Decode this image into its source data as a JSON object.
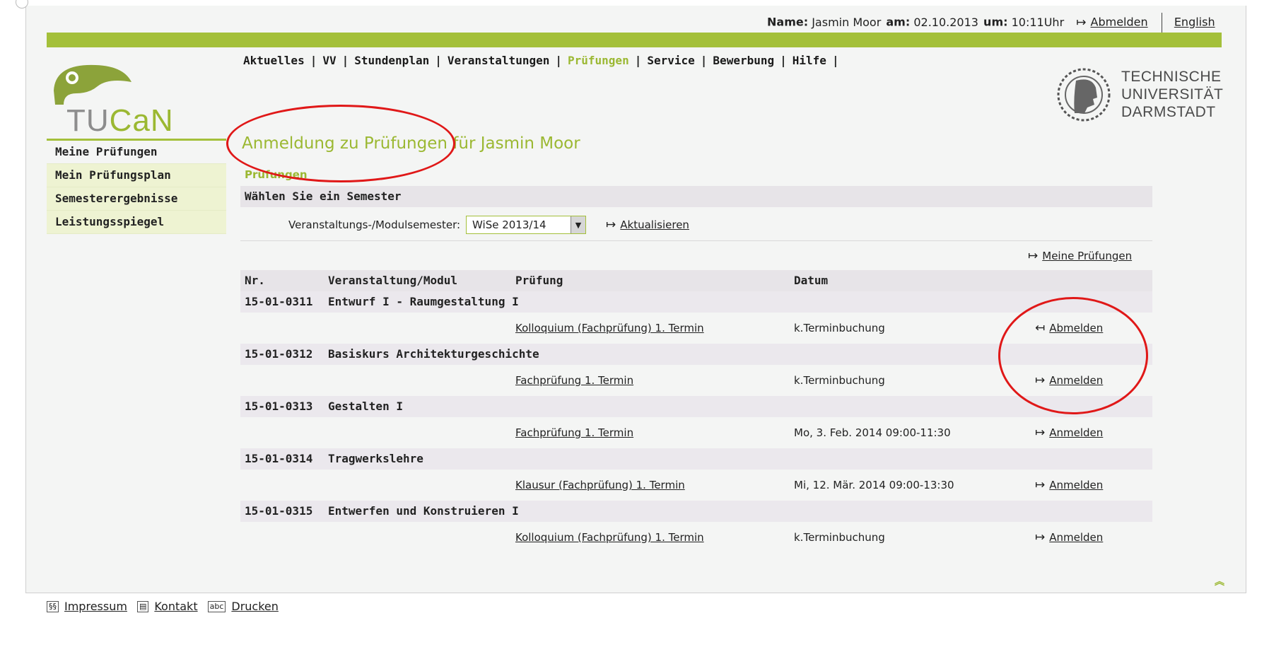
{
  "header": {
    "name_label": "Name:",
    "name_value": "Jasmin Moor",
    "date_label": "am:",
    "date_value": "02.10.2013",
    "time_label": "um:",
    "time_value": "10:11Uhr",
    "logout_label": "Abmelden",
    "language_label": "English"
  },
  "main_nav": [
    "Aktuelles",
    "VV",
    "Stundenplan",
    "Veranstaltungen",
    "Prüfungen",
    "Service",
    "Bewerbung",
    "Hilfe"
  ],
  "main_nav_active": "Prüfungen",
  "logo": {
    "text_prefix": "TU",
    "text_suffix": "CaN"
  },
  "university": {
    "line1": "TECHNISCHE",
    "line2": "UNIVERSITÄT",
    "line3": "DARMSTADT"
  },
  "sidebar": {
    "items": [
      {
        "label": "Meine Prüfungen"
      },
      {
        "label": "Mein Prüfungsplan"
      },
      {
        "label": "Semesterergebnisse"
      },
      {
        "label": "Leistungsspiegel"
      }
    ]
  },
  "page": {
    "title": "Anmeldung zu Prüfungen für Jasmin Moor",
    "breadcrumb": "Prüfungen",
    "semester_section_title": "Wählen Sie ein Semester",
    "semester_label": "Veranstaltungs-/Modulsemester:",
    "semester_value": "WiSe 2013/14",
    "refresh_label": "Aktualisieren",
    "my_exams_link": "Meine Prüfungen"
  },
  "table": {
    "headers": {
      "nr": "Nr.",
      "module": "Veranstaltung/Modul",
      "exam": "Prüfung",
      "date": "Datum"
    },
    "modules": [
      {
        "nr": "15-01-0311",
        "name": "Entwurf I - Raumgestaltung I",
        "exam": "Kolloquium (Fachprüfung) 1. Termin",
        "date": "k.Terminbuchung",
        "action": "Abmelden"
      },
      {
        "nr": "15-01-0312",
        "name": "Basiskurs Architekturgeschichte",
        "exam": "Fachprüfung 1. Termin",
        "date": "k.Terminbuchung",
        "action": "Anmelden"
      },
      {
        "nr": "15-01-0313",
        "name": "Gestalten I",
        "exam": "Fachprüfung 1. Termin",
        "date": "Mo, 3. Feb. 2014 09:00-11:30",
        "action": "Anmelden"
      },
      {
        "nr": "15-01-0314",
        "name": "Tragwerkslehre",
        "exam": "Klausur (Fachprüfung) 1. Termin",
        "date": "Mi, 12. Mär. 2014 09:00-13:30",
        "action": "Anmelden"
      },
      {
        "nr": "15-01-0315",
        "name": "Entwerfen und Konstruieren I",
        "exam": "Kolloquium (Fachprüfung) 1. Termin",
        "date": "k.Terminbuchung",
        "action": "Anmelden"
      }
    ]
  },
  "footer": {
    "impressum": "Impressum",
    "kontakt": "Kontakt",
    "drucken": "Drucken"
  },
  "colors": {
    "accent_green": "#a4c03a",
    "annotation_red": "#e01818"
  },
  "icons": [
    "arrow-right-icon",
    "arrow-left-icon",
    "dropdown-arrow-icon",
    "back-to-top-icon",
    "paragraph-icon",
    "contact-card-icon",
    "print-icon"
  ]
}
